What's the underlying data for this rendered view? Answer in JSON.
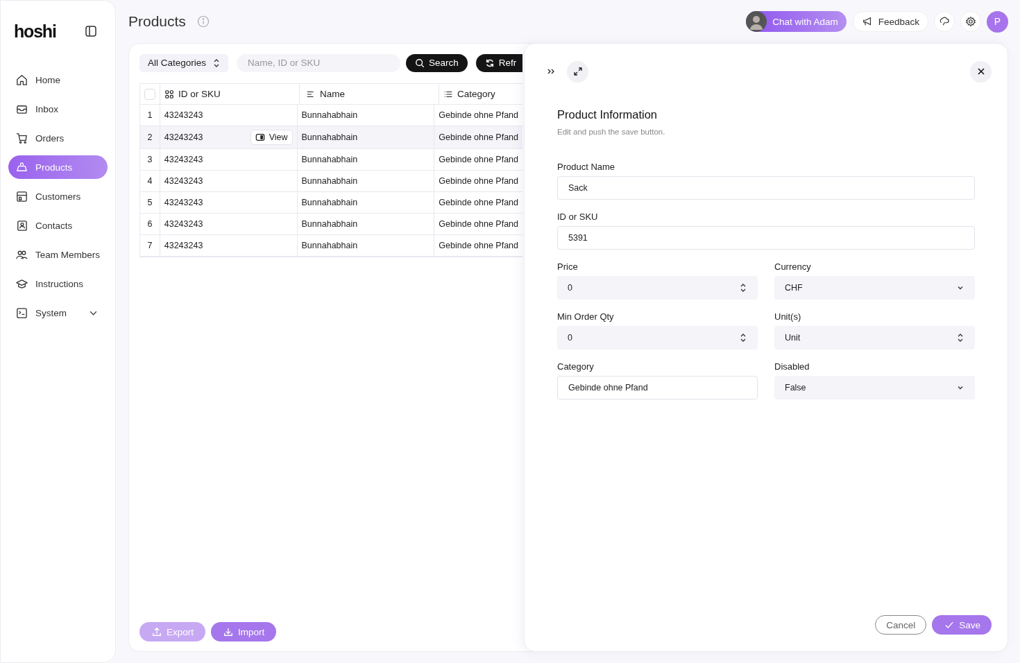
{
  "sidebar": {
    "logo": "hoshi",
    "items": [
      {
        "label": "Home",
        "selected": false
      },
      {
        "label": "Inbox",
        "selected": false
      },
      {
        "label": "Orders",
        "selected": false
      },
      {
        "label": "Products",
        "selected": true
      },
      {
        "label": "Customers",
        "selected": false
      },
      {
        "label": "Contacts",
        "selected": false
      },
      {
        "label": "Team Members",
        "selected": false
      },
      {
        "label": "Instructions",
        "selected": false
      },
      {
        "label": "System",
        "selected": false,
        "expanded": false
      }
    ]
  },
  "header": {
    "title": "Products",
    "chat": "Chat with Adam",
    "feedback": "Feedback",
    "avatar_initial": "P"
  },
  "toolbar": {
    "category_filter": "All Categories",
    "search_placeholder": "Name, ID or SKU",
    "search_button": "Search",
    "refresh_button": "Refr"
  },
  "table": {
    "columns": [
      "ID or SKU",
      "Name",
      "Category"
    ],
    "all_checked": false,
    "rows": [
      {
        "number": "1",
        "id": "43243243",
        "name": "Bunnahabhain",
        "category": "Gebinde ohne Pfand",
        "selected": false
      },
      {
        "number": "2",
        "id": "43243243",
        "name": "Bunnahabhain",
        "category": "Gebinde ohne Pfand",
        "selected": true,
        "action": "View"
      },
      {
        "number": "3",
        "id": "43243243",
        "name": "Bunnahabhain",
        "category": "Gebinde ohne Pfand",
        "selected": false
      },
      {
        "number": "4",
        "id": "43243243",
        "name": "Bunnahabhain",
        "category": "Gebinde ohne Pfand",
        "selected": false
      },
      {
        "number": "5",
        "id": "43243243",
        "name": "Bunnahabhain",
        "category": "Gebinde ohne Pfand",
        "selected": false
      },
      {
        "number": "6",
        "id": "43243243",
        "name": "Bunnahabhain",
        "category": "Gebinde ohne Pfand",
        "selected": false
      },
      {
        "number": "7",
        "id": "43243243",
        "name": "Bunnahabhain",
        "category": "Gebinde ohne Pfand",
        "selected": false
      }
    ]
  },
  "footer_buttons": [
    {
      "label": "Export",
      "disabled": true
    },
    {
      "label": "Import",
      "disabled": false
    }
  ],
  "drawer": {
    "title": "Product Information",
    "subtitle": "Edit and push the save button.",
    "form_rows": [
      [
        {
          "label": "Product Name",
          "value": "Sack",
          "kind": "text"
        }
      ],
      [
        {
          "label": "ID or SKU",
          "value": "5391",
          "kind": "text"
        }
      ],
      [
        {
          "label": "Price",
          "value": "0",
          "kind": "number"
        },
        {
          "label": "Currency",
          "value": "CHF",
          "kind": "dropdown"
        }
      ],
      [
        {
          "label": "Min Order Qty",
          "value": "0",
          "kind": "number"
        },
        {
          "label": "Unit(s)",
          "value": "Unit",
          "kind": "number"
        }
      ],
      [
        {
          "label": "Category",
          "value": "Gebinde ohne Pfand",
          "kind": "text"
        },
        {
          "label": "Disabled",
          "value": "False",
          "kind": "dropdown"
        }
      ]
    ],
    "cancel": "Cancel",
    "save": "Save"
  }
}
